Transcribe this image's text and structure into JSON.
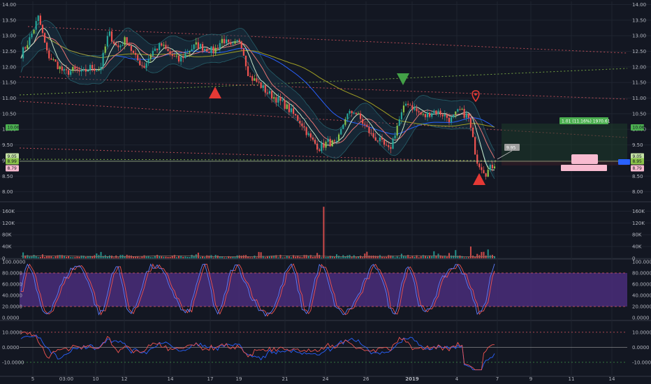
{
  "chart_data": [
    {
      "type": "line",
      "panel": "price",
      "chart_style": "candlestick",
      "y_ticks": [
        "14.00",
        "13.50",
        "13.00",
        "12.50",
        "12.00",
        "11.50",
        "11.00",
        "10.50",
        "10.00",
        "9.50",
        "9.00",
        "8.50",
        "8.00"
      ],
      "ylim": [
        7.7,
        14.1
      ],
      "close_path": [
        12.4,
        12.9,
        13.6,
        12.4,
        12.1,
        11.8,
        11.9,
        11.8,
        12.0,
        11.9,
        13.1,
        12.6,
        12.9,
        12.3,
        12.0,
        12.5,
        12.7,
        12.4,
        12.2,
        12.5,
        12.7,
        12.6,
        12.5,
        12.9,
        12.6,
        12.9,
        11.7,
        11.5,
        11.2,
        11.0,
        10.8,
        10.5,
        10.2,
        9.7,
        9.4,
        9.6,
        9.5,
        10.4,
        10.6,
        10.2,
        9.8,
        9.6,
        9.3,
        10.2,
        10.9,
        10.6,
        10.4,
        10.6,
        10.5,
        10.3,
        10.6,
        10.4,
        9.0,
        8.6,
        8.9
      ],
      "price_labels": [
        {
          "text": "10.06",
          "color": "#4caf50"
        },
        {
          "text": "9.05",
          "color": "#c5e1a5"
        },
        {
          "text": "8.99",
          "color": "#8bc34a"
        },
        {
          "text": "8.79",
          "color": "#f8bbd0"
        },
        {
          "text": "10.06",
          "color": "#4caf50"
        },
        {
          "text": "9.05",
          "color": "#c5e1a5"
        },
        {
          "text": "8.95",
          "color": "#8bc34a"
        },
        {
          "text": "8.79",
          "color": "#f8bbd0"
        }
      ],
      "annotations": [
        "1.01 (11.16%) 1970.61",
        "9.95"
      ],
      "markers": [
        {
          "kind": "up-triangle",
          "color": "#e53935"
        },
        {
          "kind": "down-triangle",
          "color": "#43a047"
        },
        {
          "kind": "pin",
          "color": "#e53935"
        },
        {
          "kind": "up-triangle",
          "color": "#e53935"
        }
      ]
    },
    {
      "type": "bar",
      "panel": "volume",
      "y_ticks": [
        "160K",
        "120K",
        "80K",
        "40K",
        "0"
      ],
      "ylim": [
        0,
        180000
      ]
    },
    {
      "type": "line",
      "panel": "stochastic",
      "y_ticks": [
        "100.0000",
        "80.0000",
        "60.0000",
        "40.0000",
        "20.0000",
        "0.0000"
      ],
      "ylim": [
        0,
        100
      ],
      "band": [
        20,
        80
      ],
      "band_color": "#4a2d7a"
    },
    {
      "type": "line",
      "panel": "oscillator",
      "y_ticks": [
        "10.0000",
        "0.0000",
        "-10.0000"
      ],
      "ylim": [
        -17,
        16
      ]
    }
  ],
  "x_axis": {
    "labels": [
      "5",
      "03:00",
      "10",
      "12",
      "14",
      "17",
      "19",
      "21",
      "24",
      "26",
      "2019",
      "4",
      "7",
      "9",
      "11",
      "14"
    ]
  },
  "colors": {
    "background": "#131722",
    "grid": "#1f2430",
    "up": "#26a69a",
    "up_alt": "#8bc34a",
    "down": "#ef5350",
    "ma_blue": "#2962ff",
    "ma_olive": "#9e9d24"
  }
}
